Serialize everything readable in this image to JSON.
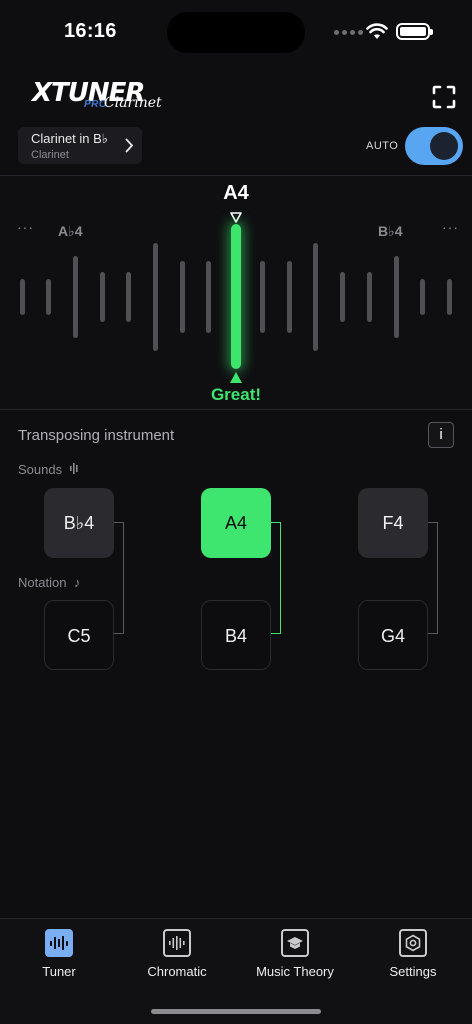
{
  "status_bar": {
    "time": "16:16"
  },
  "header": {
    "logo_main": "XTUNER",
    "logo_pro": "PRO",
    "logo_sub": "Clarinet",
    "instrument_title": "Clarinet in B♭",
    "instrument_sub": "Clarinet",
    "auto_label": "AUTO",
    "auto_on": true
  },
  "tuner": {
    "target_note": "A4",
    "left_note": "A♭4",
    "right_note": "B♭4",
    "dots": "···",
    "status": "Great!",
    "colors": {
      "in_tune": "#3de56d",
      "tick": "#4f4f55"
    }
  },
  "transposing": {
    "title": "Transposing instrument",
    "info_label": "i",
    "sounds_label": "Sounds",
    "notation_label": "Notation",
    "sounds": [
      "B♭4",
      "A4",
      "F4"
    ],
    "notation": [
      "C5",
      "B4",
      "G4"
    ],
    "active_index": 1
  },
  "tabs": [
    {
      "label": "Tuner",
      "icon": "waveform-icon",
      "active": true
    },
    {
      "label": "Chromatic",
      "icon": "chromatic-icon",
      "active": false
    },
    {
      "label": "Music Theory",
      "icon": "graduation-cap-icon",
      "active": false
    },
    {
      "label": "Settings",
      "icon": "gear-icon",
      "active": false
    }
  ]
}
